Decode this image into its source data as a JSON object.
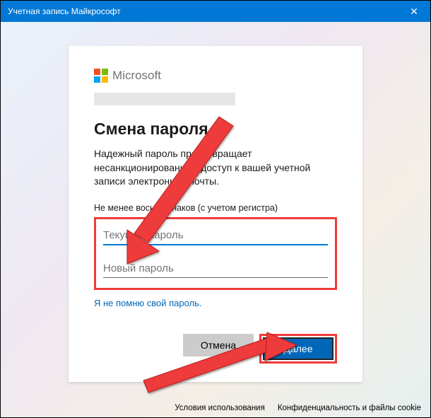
{
  "window": {
    "title": "Учетная запись Майкрософт",
    "close_glyph": "✕"
  },
  "logo": {
    "brand": "Microsoft"
  },
  "heading": "Смена пароля",
  "description": "Надежный пароль предотвращает несанкционированный доступ к вашей учетной записи электронной почты.",
  "hint": "Не менее восьми знаков (с учетом регистра)",
  "fields": {
    "current_placeholder": "Текущий пароль",
    "new_placeholder": "Новый пароль"
  },
  "links": {
    "forgot": "Я не помню свой пароль."
  },
  "buttons": {
    "cancel": "Отмена",
    "next": "Далее"
  },
  "footer": {
    "terms": "Условия использования",
    "privacy": "Конфиденциальность и файлы cookie"
  }
}
